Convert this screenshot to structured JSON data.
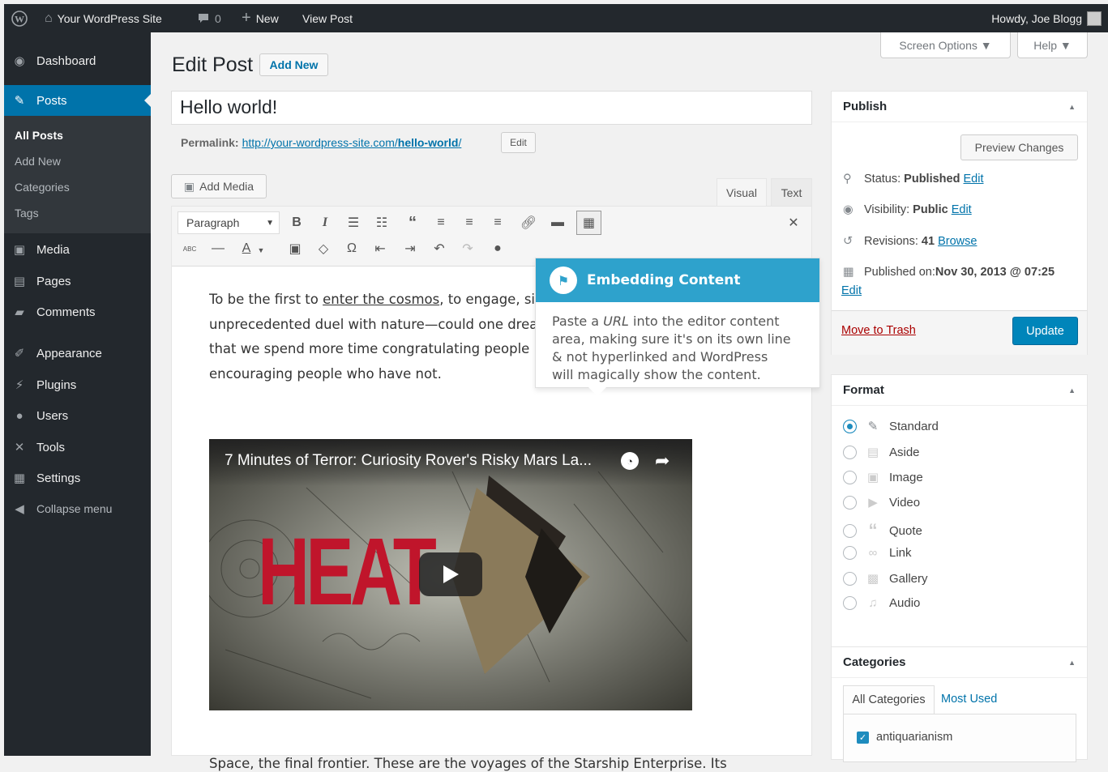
{
  "adminbar": {
    "site_name": "Your WordPress Site",
    "comments": "0",
    "new_label": "New",
    "view_label": "View Post",
    "howdy": "Howdy, Joe Blogg"
  },
  "sidebar": {
    "dashboard": "Dashboard",
    "posts": "Posts",
    "posts_sub": [
      "All Posts",
      "Add New",
      "Categories",
      "Tags"
    ],
    "media": "Media",
    "pages": "Pages",
    "comments": "Comments",
    "appearance": "Appearance",
    "plugins": "Plugins",
    "users": "Users",
    "tools": "Tools",
    "settings": "Settings",
    "collapse": "Collapse menu"
  },
  "screen_options": "Screen Options ▼",
  "help": "Help ▼",
  "page_title": "Edit Post",
  "add_new": "Add New",
  "post_title": "Hello world!",
  "permalink": {
    "label": "Permalink:",
    "url_base": "http://your-wordpress-site.com/",
    "slug": "hello-world",
    "url_end": "/",
    "edit": "Edit"
  },
  "add_media": "Add Media",
  "tabs": {
    "visual": "Visual",
    "text": "Text"
  },
  "toolbar": {
    "format": "Paragraph"
  },
  "content": {
    "para1_a": "To be the first to ",
    "para1_link": "enter the cosmos",
    "para1_b": ", to engage, si",
    "para1_l2": "unprecedented duel with nature—could one drea",
    "para1_l3": "that we spend more time congratulating people",
    "para1_l4": "encouraging people who have not.",
    "video_title": "7 Minutes of Terror: Curiosity Rover's Risky Mars La...",
    "video_word": "HEAT",
    "para2": "Space, the final frontier. These are the voyages of the Starship Enterprise. Its"
  },
  "pointer": {
    "title": "Embedding Content",
    "t1": "Paste a ",
    "t_url": "URL",
    "t2": " into the editor content",
    "l2": "area, making sure it's on its own line",
    "l3": "& not hyperlinked and WordPress",
    "l4": "will magically show the content."
  },
  "publish": {
    "title": "Publish",
    "preview": "Preview Changes",
    "status_label": "Status: ",
    "status": "Published",
    "visibility_label": "Visibility: ",
    "visibility": "Public",
    "revisions_label": "Revisions: ",
    "revisions": "41",
    "browse": "Browse",
    "published_label": "Published on: ",
    "published": "Nov 30, 2013 @ 07:25",
    "edit": "Edit",
    "trash": "Move to Trash",
    "update": "Update"
  },
  "format": {
    "title": "Format",
    "options": [
      "Standard",
      "Aside",
      "Image",
      "Video",
      "Quote",
      "Link",
      "Gallery",
      "Audio"
    ]
  },
  "categories": {
    "title": "Categories",
    "tab_all": "All Categories",
    "tab_used": "Most Used",
    "items": [
      "antiquarianism"
    ]
  },
  "colors": {
    "accent": "#0073aa",
    "sidebar": "#23282d",
    "pointer": "#2ea2cc",
    "update": "#0085ba"
  }
}
